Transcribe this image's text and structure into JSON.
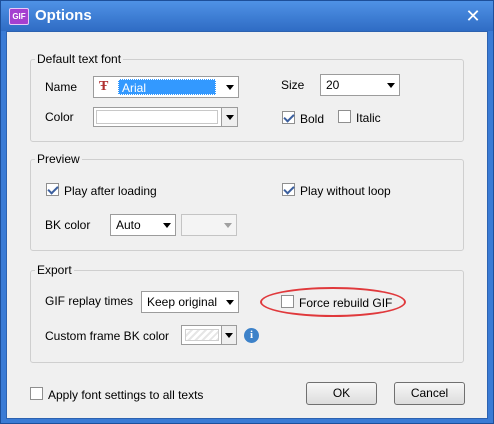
{
  "window": {
    "title": "Options",
    "app_icon_text": "GIF",
    "close_glyph": "✕"
  },
  "default_text_font": {
    "legend": "Default text font",
    "name_label": "Name",
    "font_icon": "font-type-icon",
    "font_icon_glyph": "Ŧ",
    "font_value": "Arial",
    "size_label": "Size",
    "size_value": "20",
    "color_label": "Color",
    "bold_label": "Bold",
    "bold_checked": true,
    "italic_label": "Italic",
    "italic_checked": false
  },
  "preview": {
    "legend": "Preview",
    "play_after_loading_label": "Play after loading",
    "play_after_loading_checked": true,
    "play_without_loop_label": "Play without loop",
    "play_without_loop_checked": true,
    "bk_color_label": "BK color",
    "bk_color_value": "Auto"
  },
  "export": {
    "legend": "Export",
    "gif_replay_label": "GIF replay times",
    "gif_replay_value": "Keep original",
    "force_rebuild_label": "Force rebuild GIF",
    "force_rebuild_checked": false,
    "custom_frame_label": "Custom frame BK color",
    "info_icon_glyph": "i"
  },
  "footer": {
    "apply_font_label": "Apply font settings to all texts",
    "apply_font_checked": false,
    "ok_label": "OK",
    "cancel_label": "Cancel"
  },
  "colors": {
    "title_bar": "#2f6cc4",
    "highlight": "#3399ff",
    "annotation": "#e0393c"
  }
}
